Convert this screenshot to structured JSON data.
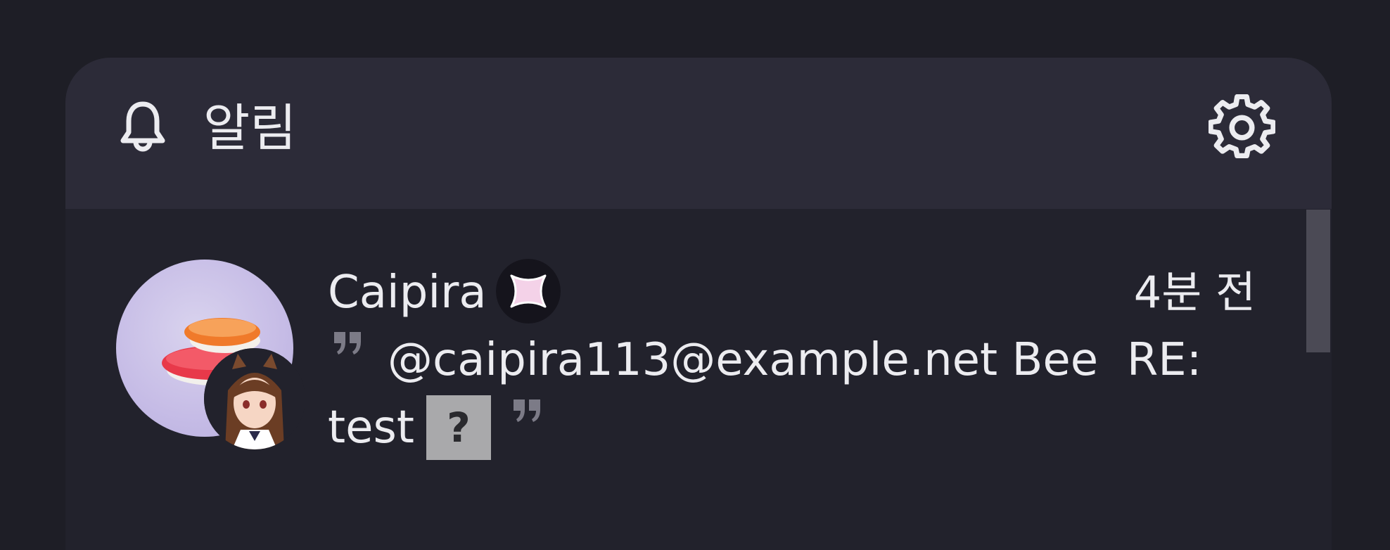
{
  "header": {
    "title": "알림",
    "bell_icon": "bell-icon",
    "settings_icon": "gear-icon"
  },
  "notification": {
    "user_name": "Caipira",
    "time": "4분 전",
    "body_line1": "@caipira113@example.net Bee  RE:",
    "body_line2": "test",
    "unknown_emoji": "?",
    "avatar_icon": "sushi-avatar",
    "sub_avatar_icon": "anime-girl-avatar",
    "badge_icon": "sparkle-badge-icon"
  },
  "colors": {
    "background": "#1e1e26",
    "header_bg": "#2c2b38",
    "panel_bg": "#22222c",
    "text": "#ececf0",
    "quote": "#7c7b87"
  }
}
